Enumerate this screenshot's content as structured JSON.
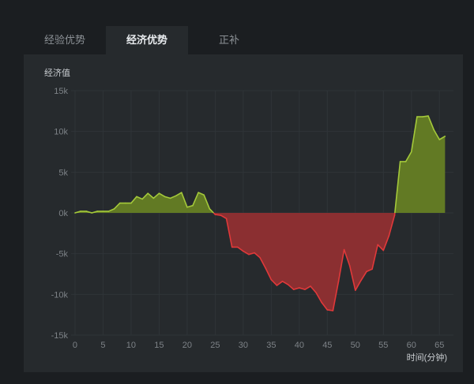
{
  "tabs": [
    {
      "label": "经验优势",
      "active": false
    },
    {
      "label": "经济优势",
      "active": true
    },
    {
      "label": "正补",
      "active": false
    }
  ],
  "chart_data": {
    "type": "area",
    "ylabel": "经济值",
    "xlabel": "时间(分钟)",
    "ylim": [
      -15000,
      15000
    ],
    "xlim": [
      -0.7,
      67.5
    ],
    "yticks": [
      15000,
      10000,
      5000,
      0,
      -5000,
      -10000,
      -15000
    ],
    "ytick_labels": [
      "15k",
      "10k",
      "5k",
      "0k",
      "-5k",
      "-10k",
      "-15k"
    ],
    "xticks": [
      0,
      5,
      10,
      15,
      20,
      25,
      30,
      35,
      40,
      45,
      50,
      55,
      60,
      65
    ],
    "xtick_labels": [
      "0",
      "5",
      "10",
      "15",
      "20",
      "25",
      "30",
      "35",
      "40",
      "45",
      "50",
      "55",
      "60",
      "65"
    ],
    "grid": true,
    "colors": {
      "positive_line": "#a4c93a",
      "positive_fill": "#627a24",
      "negative_line": "#e0393a",
      "negative_fill": "#8b2f31",
      "grid": "#2f3438"
    },
    "x": [
      0,
      1,
      2,
      3,
      4,
      5,
      6,
      7,
      8,
      9,
      10,
      11,
      12,
      13,
      14,
      15,
      16,
      17,
      18,
      19,
      20,
      21,
      22,
      23,
      24,
      25,
      26,
      27,
      28,
      29,
      30,
      31,
      32,
      33,
      34,
      35,
      36,
      37,
      38,
      39,
      40,
      41,
      42,
      43,
      44,
      45,
      46,
      47,
      48,
      49,
      50,
      51,
      52,
      53,
      54,
      55,
      56,
      57,
      58,
      59,
      60,
      61,
      62,
      63,
      64,
      65,
      66
    ],
    "y": [
      0,
      200,
      200,
      0,
      200,
      200,
      200,
      500,
      1200,
      1200,
      1200,
      2000,
      1700,
      2400,
      1800,
      2400,
      2000,
      1800,
      2100,
      2500,
      700,
      900,
      2500,
      2200,
      500,
      -200,
      -300,
      -700,
      -4200,
      -4200,
      -4700,
      -5100,
      -4900,
      -5500,
      -6800,
      -8200,
      -8900,
      -8400,
      -8800,
      -9400,
      -9200,
      -9400,
      -9000,
      -9800,
      -11000,
      -11900,
      -12000,
      -8400,
      -4500,
      -6500,
      -9500,
      -8300,
      -7200,
      -6900,
      -3900,
      -4600,
      -2800,
      -300,
      6300,
      6300,
      7500,
      11800,
      11800,
      11900,
      10200,
      9000,
      9400
    ]
  }
}
